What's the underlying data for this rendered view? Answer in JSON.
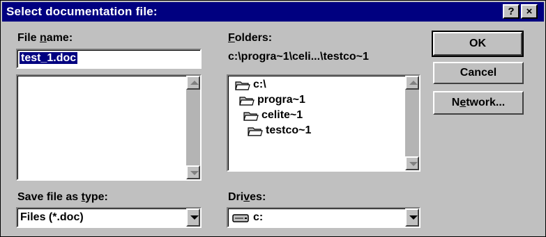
{
  "dialog": {
    "title": "Select documentation file:",
    "help_button": "?",
    "close_button": "×"
  },
  "file_name": {
    "label_pre": "File ",
    "label_u": "n",
    "label_post": "ame:",
    "value": "test_1.doc",
    "files": []
  },
  "folders": {
    "label_u": "F",
    "label_post": "olders:",
    "current_path": "c:\\progra~1\\celi...\\testco~1",
    "items": [
      {
        "label": "c:\\",
        "icon": "open-folder-icon"
      },
      {
        "label": "progra~1",
        "icon": "open-folder-icon"
      },
      {
        "label": "celite~1",
        "icon": "open-folder-icon"
      },
      {
        "label": "testco~1",
        "icon": "open-folder-icon"
      }
    ]
  },
  "save_type": {
    "label_pre": "Save file as ",
    "label_u": "t",
    "label_post": "ype:",
    "value": "Files (*.doc)"
  },
  "drives": {
    "label_pre": "Dri",
    "label_u": "v",
    "label_post": "es:",
    "value": "c:",
    "icon": "drive-icon"
  },
  "buttons": {
    "ok": "OK",
    "cancel": "Cancel",
    "network_pre": "N",
    "network_u": "e",
    "network_post": "twork..."
  },
  "colors": {
    "titlebar": "#000080",
    "face": "#c0c0c0",
    "selection": "#000080"
  }
}
